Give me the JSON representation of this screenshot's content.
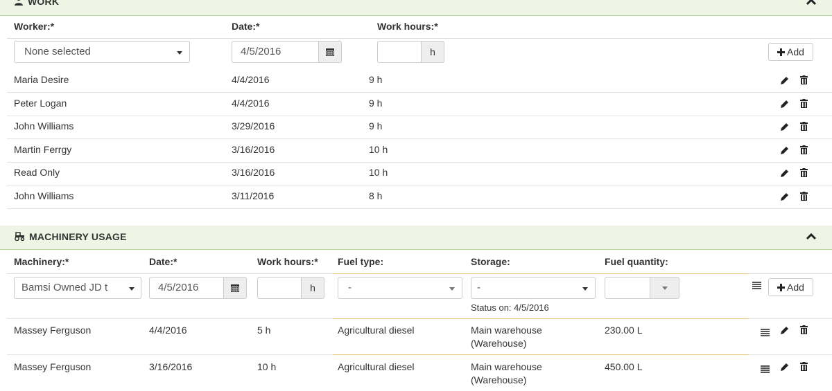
{
  "work": {
    "title": "WORK",
    "headers": {
      "worker": "Worker:*",
      "date": "Date:*",
      "hours": "Work hours:*"
    },
    "form": {
      "worker_value": "None selected",
      "date_value": "4/5/2016",
      "hours_unit": "h",
      "add_label": "Add"
    },
    "rows": [
      {
        "worker": "Maria Desire",
        "date": "4/4/2016",
        "hours": "9 h"
      },
      {
        "worker": "Peter Logan",
        "date": "4/4/2016",
        "hours": "9 h"
      },
      {
        "worker": "John Williams",
        "date": "3/29/2016",
        "hours": "9 h"
      },
      {
        "worker": "Martin Ferrgy",
        "date": "3/16/2016",
        "hours": "10 h"
      },
      {
        "worker": "Read Only",
        "date": "3/16/2016",
        "hours": "10 h"
      },
      {
        "worker": "John Williams",
        "date": "3/11/2016",
        "hours": "8 h"
      }
    ]
  },
  "machinery": {
    "title": "MACHINERY USAGE",
    "headers": {
      "machinery": "Machinery:*",
      "date": "Date:*",
      "hours": "Work hours:*",
      "fuel_type": "Fuel type:",
      "storage": "Storage:",
      "fuel_qty": "Fuel quantity:"
    },
    "form": {
      "machinery_value": "Bamsi Owned JD t",
      "date_value": "4/5/2016",
      "hours_unit": "h",
      "fuel_type_value": "-",
      "storage_value": "-",
      "status_text": "Status on: 4/5/2016",
      "add_label": "Add"
    },
    "rows": [
      {
        "machinery": "Massey Ferguson",
        "date": "4/4/2016",
        "hours": "5 h",
        "fuel_type": "Agricultural diesel",
        "storage_line1": "Main warehouse",
        "storage_line2": "(Warehouse)",
        "fuel_qty": "230.00 L"
      },
      {
        "machinery": "Massey Ferguson",
        "date": "3/16/2016",
        "hours": "10 h",
        "fuel_type": "Agricultural diesel",
        "storage_line1": "Main warehouse",
        "storage_line2": "(Warehouse)",
        "fuel_qty": "450.00 L"
      }
    ]
  },
  "colors": {
    "panel_bg": "#eef5e4",
    "panel_border": "#b9d79a",
    "fuel_divider": "#e8c87a"
  }
}
